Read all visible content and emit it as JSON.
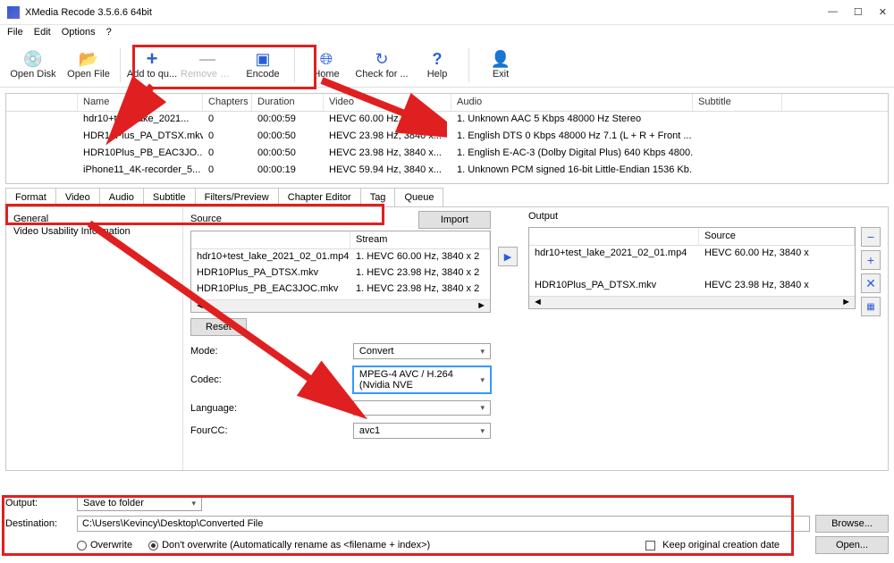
{
  "window": {
    "title": "XMedia Recode 3.5.6.6 64bit"
  },
  "menu": {
    "file": "File",
    "edit": "Edit",
    "options": "Options",
    "help": "?"
  },
  "toolbar": {
    "open_disk": "Open Disk",
    "open_file": "Open File",
    "add_queue": "Add to qu...",
    "remove_job": "Remove Job",
    "encode": "Encode",
    "home": "Home",
    "check": "Check for ...",
    "helpbtn": "Help",
    "exit": "Exit"
  },
  "filecols": {
    "name": "Name",
    "chapters": "Chapters",
    "duration": "Duration",
    "video": "Video",
    "audio": "Audio",
    "subtitle": "Subtitle"
  },
  "files": [
    {
      "name": "hdr10+test_lake_2021...",
      "ch": "0",
      "dur": "00:00:59",
      "vid": "HEVC 60.00 Hz, 3840 x...",
      "aud": "1. Unknown AAC 5 Kbps 48000 Hz Stereo"
    },
    {
      "name": "HDR10Plus_PA_DTSX.mkv",
      "ch": "0",
      "dur": "00:00:50",
      "vid": "HEVC 23.98 Hz, 3840 x...",
      "aud": "1. English DTS 0 Kbps 48000 Hz 7.1 (L + R + Front ..."
    },
    {
      "name": "HDR10Plus_PB_EAC3JO...",
      "ch": "0",
      "dur": "00:00:50",
      "vid": "HEVC 23.98 Hz, 3840 x...",
      "aud": "1. English E-AC-3 (Dolby Digital Plus) 640 Kbps 4800..."
    },
    {
      "name": "iPhone11_4K-recorder_5...",
      "ch": "0",
      "dur": "00:00:19",
      "vid": "HEVC 59.94 Hz, 3840 x...",
      "aud": "1. Unknown PCM signed 16-bit Little-Endian 1536 Kb..."
    }
  ],
  "tabs": {
    "format": "Format",
    "video": "Video",
    "audio": "Audio",
    "subtitle": "Subtitle",
    "filters": "Filters/Preview",
    "chapter": "Chapter Editor",
    "tag": "Tag",
    "queue": "Queue"
  },
  "side": {
    "general": "General",
    "vui": "Video Usability Information"
  },
  "panel": {
    "source_lbl": "Source",
    "output_lbl": "Output",
    "stream_col": "Stream",
    "source_col": "Source",
    "import": "Import",
    "reset": "Reset",
    "mode": "Mode:",
    "mode_val": "Convert",
    "codec": "Codec:",
    "codec_val": "MPEG-4 AVC / H.264 (Nvidia NVE",
    "language": "Language:",
    "fourcc": "FourCC:",
    "fourcc_val": "avc1"
  },
  "source_items": [
    {
      "n": "hdr10+test_lake_2021_02_01.mp4",
      "s": "1. HEVC 60.00 Hz, 3840 x 2"
    },
    {
      "n": "HDR10Plus_PA_DTSX.mkv",
      "s": "1. HEVC 23.98 Hz, 3840 x 2"
    },
    {
      "n": "HDR10Plus_PB_EAC3JOC.mkv",
      "s": "1. HEVC 23.98 Hz, 3840 x 2"
    }
  ],
  "output_items": [
    {
      "n": "hdr10+test_lake_2021_02_01.mp4",
      "s": "HEVC 60.00 Hz, 3840 x"
    },
    {
      "n": "",
      "s": ""
    },
    {
      "n": "HDR10Plus_PA_DTSX.mkv",
      "s": "HEVC 23.98 Hz, 3840 x"
    }
  ],
  "bottom": {
    "output": "Output:",
    "output_val": "Save to folder",
    "dest": "Destination:",
    "dest_val": "C:\\Users\\Kevincy\\Desktop\\Converted File",
    "browse": "Browse...",
    "open": "Open...",
    "overwrite": "Overwrite",
    "dont": "Don't overwrite (Automatically rename as <filename + index>)",
    "keep": "Keep original creation date"
  }
}
